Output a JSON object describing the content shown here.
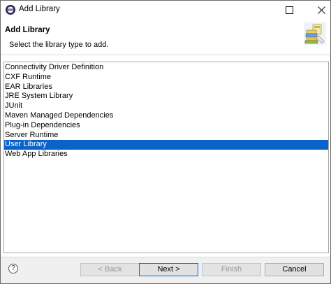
{
  "window": {
    "title": "Add Library"
  },
  "header": {
    "title": "Add Library",
    "description": "Select the library type to add.",
    "icon": "library-books-icon"
  },
  "library_types": {
    "items": [
      "Connectivity Driver Definition",
      "CXF Runtime",
      "EAR Libraries",
      "JRE System Library",
      "JUnit",
      "Maven Managed Dependencies",
      "Plug-in Dependencies",
      "Server Runtime",
      "User Library",
      "Web App Libraries"
    ],
    "selected": "User Library"
  },
  "footer": {
    "help": "?",
    "back_label": "< Back",
    "next_label": "Next >",
    "finish_label": "Finish",
    "cancel_label": "Cancel"
  },
  "colors": {
    "selection": "#0a64c8",
    "footer_bg": "#f0f0f0"
  }
}
